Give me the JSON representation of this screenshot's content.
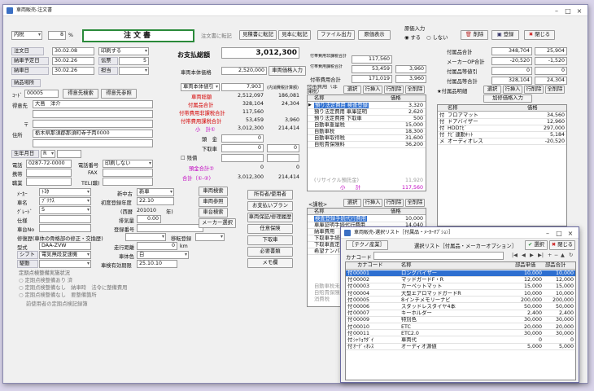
{
  "app": {
    "title": "車両販売-注文書"
  },
  "header": {
    "tax_mode": "内税",
    "tax_rate": "8",
    "tax_unit": "%",
    "doc_title": "注文書",
    "btn_transfer": "注文書に転記",
    "btn_quote": "見積書に転記",
    "btn_contract": "見本に転記",
    "btn_file": "ファイル出力",
    "btn_original": "原価表示",
    "print_label": "原価入力",
    "radio_yes": "する",
    "radio_no": "しない",
    "btn_delete": "削除",
    "btn_register": "登録",
    "btn_close": "閉じる"
  },
  "left": {
    "order_date_label": "注文日",
    "order_date": "30.02.08",
    "print_mode": "印刷する",
    "delivery_plan_label": "納車予定日",
    "delivery_plan": "30.02.26",
    "slip_label": "伝票",
    "slip_no": "5",
    "delivery_label": "納車日",
    "delivery_date": "30.02.26",
    "staff_label": "担当",
    "sales_place": "納品場所",
    "code_label": "ｺｰﾄﾞ",
    "code": "00005",
    "btn_customer_search": "得意先検索",
    "btn_customer_ref": "得意先参照",
    "customer_label": "得意先",
    "customer_name": "大島　洋介",
    "zip_label": "〒",
    "addr_label": "住所",
    "address": "栃木県那須郡那須町寺子丙0000",
    "birth_label": "生年月日",
    "birth_era": "R",
    "tel_label": "電話",
    "tel": "0287-72-0000",
    "phone_no_label": "電話番号",
    "phone_print": "印刷しない",
    "mobile_label": "携帯",
    "fax_label": "FAX",
    "job_label": "職業",
    "tel2_label": "TEL(職)"
  },
  "totals": {
    "pay_total_label": "お支払総額",
    "pay_total": "3,012,300",
    "body_price_label": "車両本体価格",
    "body_price": "2,520,000",
    "btn_body_input": "車両価格入力",
    "discount_label": "車両本体値引",
    "discount": "7,903",
    "tax_note": "(内消費税計算額)",
    "car_total_label": "車両総額",
    "car_total": "2,512,097",
    "car_tax": "186,081",
    "acc_total_label": "付属品合計",
    "acc_total": "328,104",
    "acc_tax": "24,304",
    "cost_tax_label": "付帯費用非課税合計",
    "cost_tax": "117,560",
    "cost_taxable_label": "付帯費用課税合計",
    "cost_taxable": "53,459",
    "cost_taxable_tax": "3,960",
    "subtotal_label": "小　計①",
    "subtotal": "3,012,300",
    "subtotal_tax": "214,414",
    "tradein_label": "頭　金",
    "tradein": "0",
    "down_label": "下取車",
    "down": "0",
    "down_tax": "0",
    "check_label": "残債",
    "prepay_label": "預金合計②",
    "prepay": "0",
    "prepay_tax": "0",
    "grand_label": "合計（①-②）",
    "grand": "3,012,300",
    "grand_tax": "214,414"
  },
  "car": {
    "maker_label": "ﾒｰｶｰ",
    "maker": "ﾄﾖﾀ",
    "newused_label": "新中古",
    "newused": "新車",
    "name_label": "車名",
    "name": "ﾌﾟﾘｳｽ",
    "first_reg_label": "初度登録年度",
    "first_reg": "22.10",
    "grade_label": "ｸﾞﾚｰﾄﾞ",
    "grade": "S",
    "year_label": "(西暦",
    "year": "201010",
    "year_suffix": "年)",
    "spec_label": "仕様",
    "displacement_label": "排気量",
    "displacement": "0.00",
    "chassis_label": "車台No",
    "regno_label": "登録番号",
    "repair_label": "修復歴(車体の骨格部の修正・交換歴)",
    "transfer_label": "移転登録",
    "model_label": "型式",
    "model": "DAA-ZVW",
    "mileage_label": "走行距離",
    "mileage": "0",
    "mileage_unit": "km",
    "shift_label": "シフト",
    "shift": "電気無段変速機",
    "color_label": "車体色",
    "color": "白",
    "drive_label": "駆動",
    "inspect_label": "車検有効期限",
    "inspect": "25.10.10",
    "inspect_head": "定期点検整備実施状況",
    "opt1": "定期点検整備あり",
    "opt1b": "済",
    "opt2": "定期点検整備なし",
    "opt2b": "納車時",
    "opt2c": "法令に整備費用",
    "opt3": "定期点検整備なし",
    "opt3b": "要整備箇所",
    "opt4": "前使用者の定期点検記録簿"
  },
  "midbtns": {
    "car_search": "車両検索",
    "car_ref": "車両参照",
    "car_register": "車台検索",
    "maker_select": "メーカー選択",
    "owner": "所有者/使用者",
    "plan": "お支払いプラン",
    "warranty": "車両保証/修理履歴",
    "insurance": "任意保険",
    "down_car": "下取車",
    "docs": "必要書類",
    "memo": "メモ欄"
  },
  "costs": {
    "nontax_label": "付帯費用非課税合計",
    "nontax": "117,560",
    "taxable_label": "付帯費用課税合計",
    "taxable": "53,459",
    "taxable_tax": "3,960",
    "total_label": "付帯費用合計",
    "total": "171,019",
    "total_tax": "3,960",
    "grid_title": "付帯費用（非課税）",
    "btn_select": "選択",
    "btn_insert": "行挿入",
    "btn_delete_row": "行削除",
    "btn_delete_all": "全削除",
    "col_name": "名称",
    "col_price": "価格",
    "rows": [
      {
        "name": "預り法定費用 検査登録",
        "price": "3,320"
      },
      {
        "name": "預り法定費用 車庫証明",
        "price": "2,620"
      },
      {
        "name": "預り法定費用 下取車",
        "price": "500"
      },
      {
        "name": "自動車重量税",
        "price": "15,000"
      },
      {
        "name": "自動車税",
        "price": "18,300"
      },
      {
        "name": "自動車取得税",
        "price": "31,600"
      },
      {
        "name": "自賠責保険料",
        "price": "36,200"
      }
    ],
    "recycle_label": "(リサイクル預託金)",
    "recycle": "11,920",
    "sub_label": "小　　計",
    "sub": "117,560",
    "grid2_title": "課税",
    "grid2_rows": [
      "検査登録手続代行費用",
      "車庫証明手続代行費用",
      "納車費用",
      "下取車手続代行費用",
      "下取車査定料",
      "希望ナンバー"
    ],
    "grid2_price": "10,000",
    "grid2_price2": "14,040",
    "grid2_extra": [
      "自動車税未経過分相当額",
      "自賠責保険料未経過分",
      "消費税"
    ]
  },
  "acc": {
    "total_label": "付属品合計",
    "total": "348,704",
    "total_tax": "25,904",
    "maker_label": "メーカーOP合計",
    "maker": "-20,520",
    "maker_tax": "-1,520",
    "disc_label": "付属品等値引",
    "disc": "0",
    "disc_tax": "0",
    "sum_label": "付属品等合計",
    "sum": "328,104",
    "sum_tax": "24,304",
    "grid_title": "付属品明細",
    "btn_select": "選択",
    "btn_insert": "行挿入",
    "btn_delete_row": "行削除",
    "btn_delete_all": "全削除",
    "btn_add": "加修価格入力",
    "col_name": "名称",
    "col_price": "価格",
    "rows": [
      {
        "k": "付",
        "name": "フロアマット",
        "price": "34,560"
      },
      {
        "k": "付",
        "name": "ドアバイザー",
        "price": "12,960"
      },
      {
        "k": "付",
        "name": "HDDﾅﾋﾞ",
        "price": "297,000"
      },
      {
        "k": "付",
        "name": "ﾅﾋﾞ連動ｷｯﾄ",
        "price": "5,184"
      },
      {
        "k": "メ",
        "name": "オーディオレス",
        "price": "-20,520"
      }
    ]
  },
  "popup": {
    "title": "車両販売-選択リスト［付属品・ﾒｰｶｰｵﾌﾟｼｮﾝ］",
    "tab": "［テクノ産業］",
    "heading": "選択リスト［付属品・メーカーオプション］",
    "btn_select": "選択",
    "btn_close": "閉じる",
    "search_label": "カナコード",
    "col_code": "カナコード",
    "col_name": "名称",
    "col_price": "部品単価",
    "col_total": "部品合計",
    "rows": [
      {
        "k": "付",
        "code": "00001",
        "name": "ロングバイザー",
        "price": "10,000",
        "total": "10,000"
      },
      {
        "k": "付",
        "code": "00002",
        "name": "マッドガードF・R",
        "price": "12,000",
        "total": "12,000"
      },
      {
        "k": "付",
        "code": "00003",
        "name": "カーペットマット",
        "price": "15,000",
        "total": "15,000"
      },
      {
        "k": "付",
        "code": "00004",
        "name": "大型エアロマッドガードR",
        "price": "10,000",
        "total": "10,000"
      },
      {
        "k": "付",
        "code": "00005",
        "name": "8インチメモリーナビ",
        "price": "200,000",
        "total": "200,000"
      },
      {
        "k": "付",
        "code": "00006",
        "name": "スタッドレスタイヤ4本",
        "price": "50,000",
        "total": "50,000"
      },
      {
        "k": "付",
        "code": "00007",
        "name": "キーホルダー",
        "price": "2,400",
        "total": "2,400"
      },
      {
        "k": "付",
        "code": "00009",
        "name": "特別色",
        "price": "30,000",
        "total": "30,000"
      },
      {
        "k": "付",
        "code": "00010",
        "name": "ETC",
        "price": "20,000",
        "total": "20,000"
      },
      {
        "k": "付",
        "code": "00011",
        "name": "ETC2.0",
        "price": "30,000",
        "total": "30,000"
      },
      {
        "k": "付",
        "code": "ｼｬﾘｮｳﾀﾞｲ",
        "name": "車両代",
        "price": "0",
        "total": "0"
      },
      {
        "k": "付",
        "code": "ｵｰﾃﾞｨｵﾚｽ",
        "name": "オーディオ源値",
        "price": "5,000",
        "total": "5,000"
      }
    ]
  }
}
